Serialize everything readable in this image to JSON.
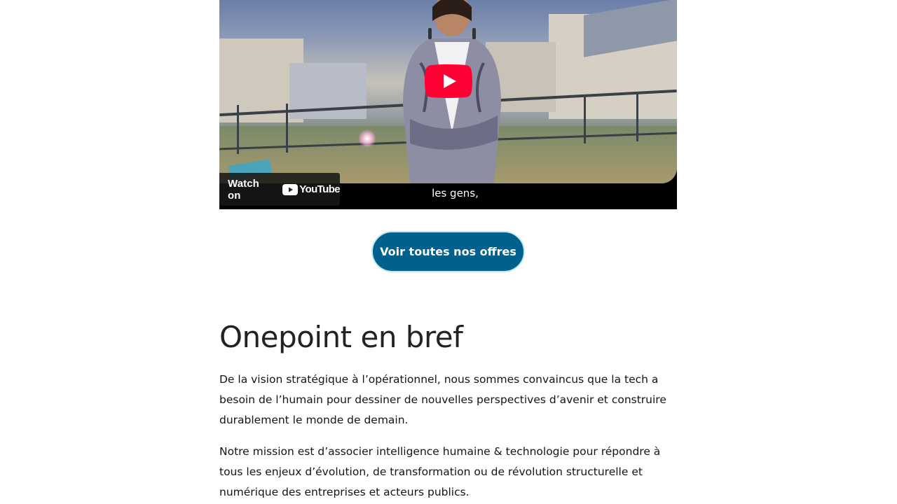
{
  "video": {
    "caption": "les gens,",
    "watch_on_label": "Watch on",
    "youtube_wordmark": "YouTube",
    "play_icon": "play-icon",
    "accent_red": "#ff0033"
  },
  "cta": {
    "label": "Voir toutes nos offres",
    "color": "#00618e"
  },
  "section": {
    "title": "Onepoint en bref",
    "paragraphs": [
      "De la vision stratégique à l’opérationnel, nous sommes convaincus que la tech a besoin de l’humain pour dessiner de nouvelles perspectives d’avenir et construire durablement le monde de demain.",
      "Notre mission est d’associer intelligence humaine & technologie pour répondre à tous les enjeux d’évolution, de transformation ou de révolution structurelle et numérique des entreprises et acteurs publics."
    ]
  }
}
